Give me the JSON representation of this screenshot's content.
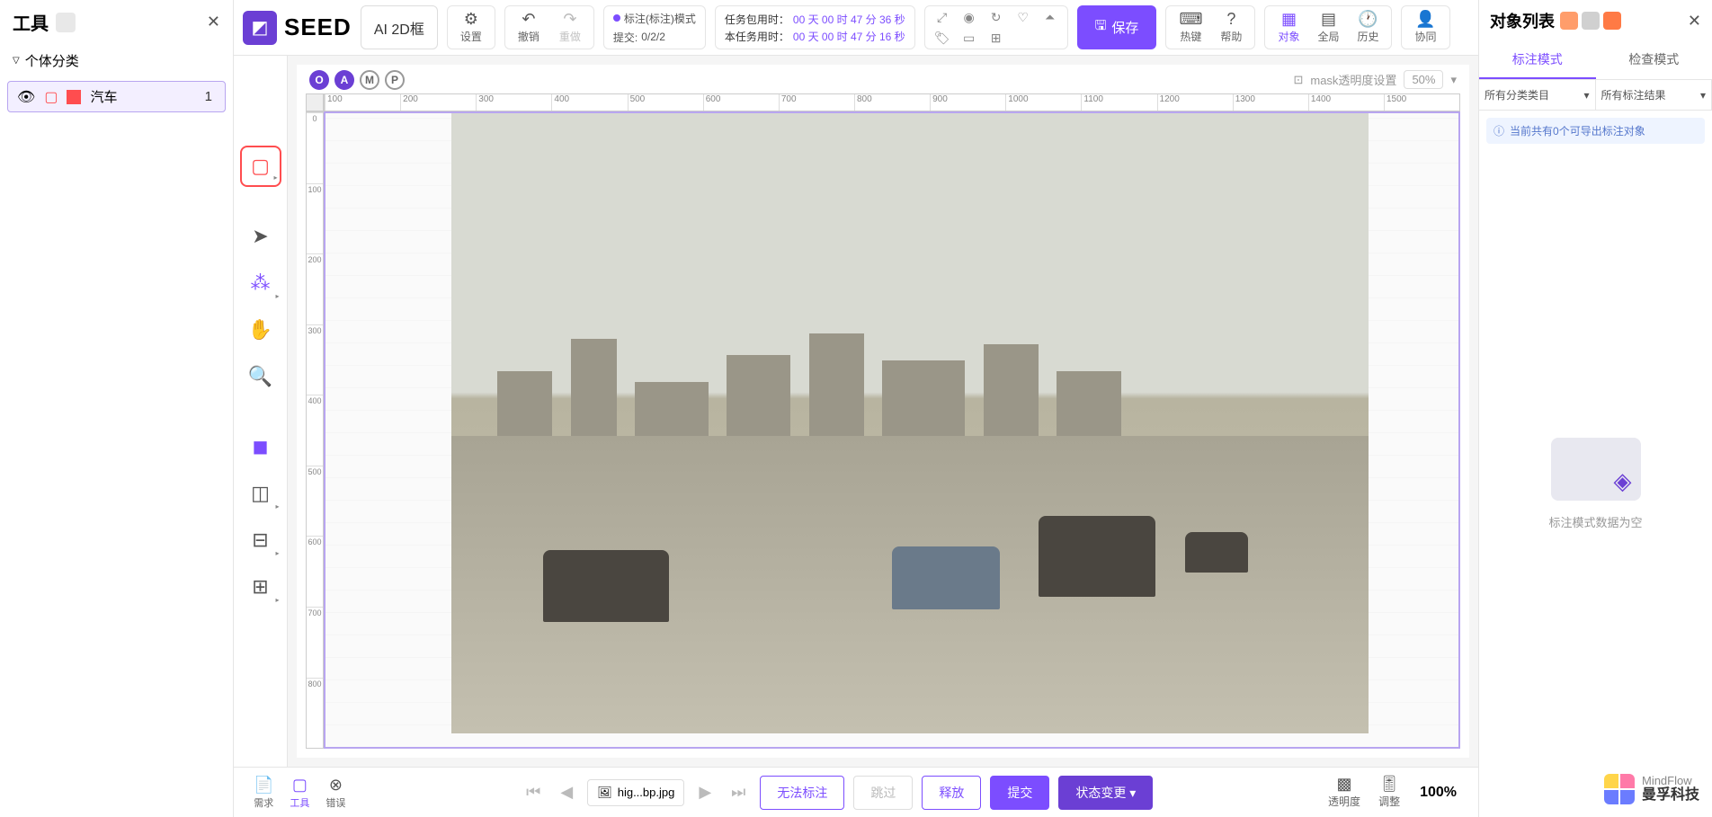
{
  "left": {
    "title": "工具",
    "category": "个体分类",
    "class": {
      "name": "汽车",
      "count": "1"
    }
  },
  "toolbar": {
    "logo": "SEED",
    "ai_badge": "AI 2D框",
    "settings": "设置",
    "undo": "撤销",
    "redo": "重做",
    "mode_line1": "标注(标注)模式",
    "mode_line2_label": "提交:",
    "mode_line2_value": "0/2/2",
    "timer1_label": "任务包用时：",
    "timer1_value": "00 天 00 时 47 分 36 秒",
    "timer2_label": "本任务用时：",
    "timer2_value": "00 天 00 时 47 分 16 秒",
    "save": "保存",
    "hotkey": "热键",
    "help": "帮助",
    "objects": "对象",
    "global": "全局",
    "history": "历史",
    "collab": "协同"
  },
  "canvas": {
    "badges": [
      "O",
      "A",
      "M",
      "P"
    ],
    "mask_label": "mask透明度设置",
    "mask_value": "50%",
    "ruler_h": [
      "100",
      "200",
      "300",
      "400",
      "500",
      "600",
      "700",
      "800",
      "900",
      "1000",
      "1100",
      "1200",
      "1300",
      "1400",
      "1500"
    ],
    "ruler_v": [
      "0",
      "100",
      "200",
      "300",
      "400",
      "500",
      "600",
      "700",
      "800"
    ]
  },
  "bottom": {
    "tabs": {
      "req": "需求",
      "tool": "工具",
      "err": "错误"
    },
    "filename": "hig...bp.jpg",
    "cant_annotate": "无法标注",
    "skip": "跳过",
    "release": "释放",
    "submit": "提交",
    "status_change": "状态变更",
    "opacity": "透明度",
    "adjust": "调整",
    "zoom": "100%"
  },
  "right": {
    "title": "对象列表",
    "tab_annotate": "标注模式",
    "tab_inspect": "检查模式",
    "filter1": "所有分类类目",
    "filter2": "所有标注结果",
    "notice": "当前共有0个可导出标注对象",
    "empty_text": "标注模式数据为空",
    "brand_en": "MindFlow",
    "brand_cn": "曼孚科技"
  }
}
